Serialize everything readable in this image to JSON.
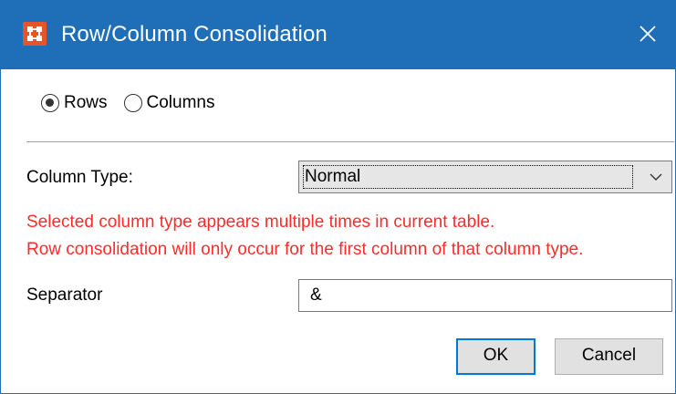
{
  "window": {
    "title": "Row/Column Consolidation"
  },
  "consolidate_mode": {
    "options": [
      {
        "label": "Rows",
        "checked": true
      },
      {
        "label": "Columns",
        "checked": false
      }
    ]
  },
  "column_type": {
    "label": "Column Type:",
    "selected": "Normal"
  },
  "warning": {
    "line1": "Selected column type appears multiple times in current table.",
    "line2": "Row consolidation will only occur for the first column of that column type.",
    "color": "#ff2a2a"
  },
  "separator": {
    "label": "Separator",
    "value": "&"
  },
  "buttons": {
    "ok": "OK",
    "cancel": "Cancel"
  },
  "colors": {
    "titlebar": "#1e6fb8",
    "app_icon": "#e8542a",
    "default_button_border": "#0078d7"
  },
  "icons": {
    "app": "app-logo-icon",
    "close": "close-icon",
    "dropdown": "chevron-down-icon"
  }
}
